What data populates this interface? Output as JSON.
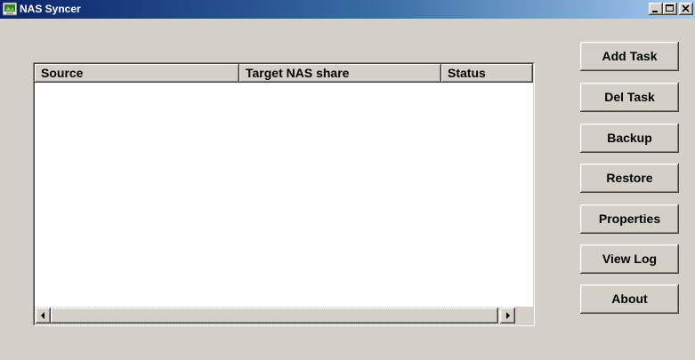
{
  "window": {
    "title": "NAS Syncer",
    "app_icon": "nas-sync-icon",
    "caption_buttons": [
      "minimize-icon",
      "maximize-icon",
      "close-icon"
    ]
  },
  "task_list": {
    "columns": [
      "Source",
      "Target NAS share",
      "Status"
    ],
    "rows": []
  },
  "buttons": {
    "add_task": "Add Task",
    "del_task": "Del Task",
    "backup": "Backup",
    "restore": "Restore",
    "properties": "Properties",
    "view_log": "View Log",
    "about": "About"
  },
  "colors": {
    "titlebar_start": "#0a246a",
    "titlebar_end": "#a6caf0",
    "face": "#d4d0c8"
  }
}
